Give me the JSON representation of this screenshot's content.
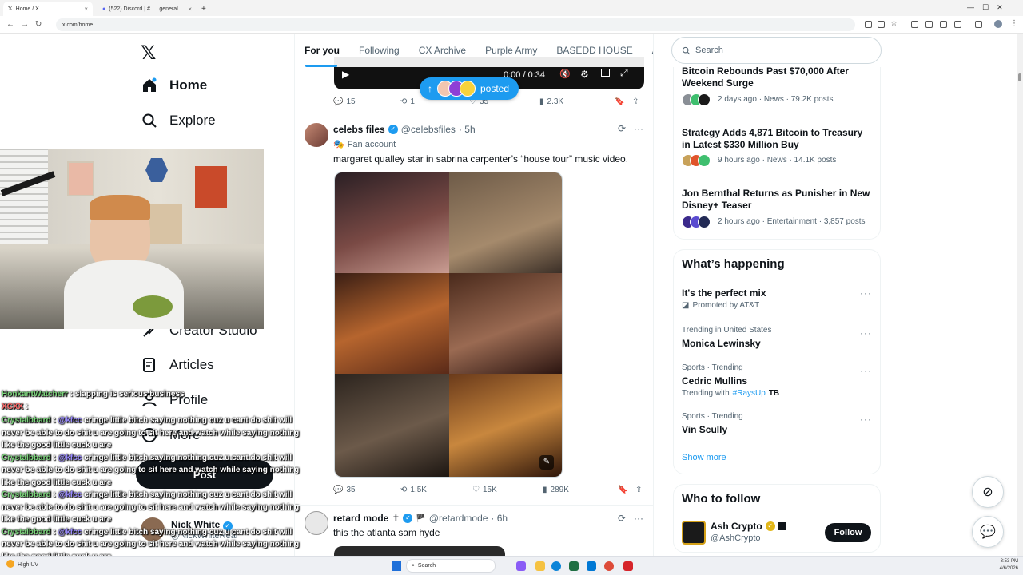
{
  "browser": {
    "tabs": [
      {
        "title": "Home / X"
      },
      {
        "title": "(522) Discord | #... | general"
      }
    ],
    "url": "x.com/home"
  },
  "left_nav": {
    "items": [
      {
        "label": "Home",
        "icon": "home-icon"
      },
      {
        "label": "Explore",
        "icon": "search-icon"
      },
      {
        "label": "Creator Studio",
        "icon": "creator-icon"
      },
      {
        "label": "Articles",
        "icon": "articles-icon"
      },
      {
        "label": "Profile",
        "icon": "profile-icon"
      },
      {
        "label": "More",
        "icon": "more-icon"
      }
    ],
    "post_button": "Post",
    "account": {
      "name": "Nick White",
      "handle": "@NickWhiteReal"
    }
  },
  "chat": [
    {
      "user": "HonkantWatcherr",
      "text": "slapping",
      "text2": "is serious business"
    },
    {
      "user": "XCXX",
      "text": ":"
    },
    {
      "user": "Crystalbbard",
      "mention": "@kfcc",
      "text": "cringe little bitch saying nothing cuz u cant do shit will never be able to do shit u are going to sit here and watch while saying nothing like the good little cuck u are"
    },
    {
      "user": "Crystalbbard",
      "mention": "@kfcc",
      "text": "cringe little bitch saying nothing cuz u cant do shit will never be able to do shit u are going to sit here and watch while saying nothing like the good little cuck u are"
    },
    {
      "user": "Crystalbbard",
      "mention": "@kfcc",
      "text": "cringe little bitch saying nothing cuz u cant do shit will never be able to do shit u are going to sit here and watch while saying nothing like the good little cuck u are"
    },
    {
      "user": "Crystalbbard",
      "mention": "@kfcc",
      "text": "cringe little bitch saying nothing cuz u cant do shit will never be able to do shit u are going to sit here and watch while saying nothing like the good little cuck u are"
    }
  ],
  "feed": {
    "tabs": [
      "For you",
      "Following",
      "CX Archive",
      "Purple Army",
      "BASEDD HOUSE",
      "Ape"
    ],
    "new_posts_pill": "posted",
    "video_time": "0:00 / 0:34",
    "post1_actions": {
      "replies": "15",
      "reposts": "1",
      "likes": "35",
      "views": "2.3K"
    },
    "post2": {
      "name": "celebs files",
      "handle": "@celebsfiles",
      "time": "· 5h",
      "label": "Fan account",
      "text": "margaret qualley star in sabrina carpenter’s “house tour” music video.",
      "actions": {
        "replies": "35",
        "reposts": "1.5K",
        "likes": "15K",
        "views": "289K"
      }
    },
    "post3": {
      "name": "retard mode",
      "handle": "@retardmode",
      "time": "· 6h",
      "text": "this the atlanta sam hyde"
    }
  },
  "sidebar": {
    "search_placeholder": "Search",
    "news": [
      {
        "title": "Bitcoin Rebounds Past $70,000 After Weekend Surge",
        "meta": "2 days ago · News · 79.2K posts"
      },
      {
        "title": "Strategy Adds 4,871 Bitcoin to Treasury in Latest $330 Million Buy",
        "meta": "9 hours ago · News · 14.1K posts"
      },
      {
        "title": "Jon Bernthal Returns as Punisher in New Disney+ Teaser",
        "meta": "2 hours ago · Entertainment · 3,857 posts"
      }
    ],
    "whats_happening": {
      "title": "What’s happening",
      "items": [
        {
          "context": "",
          "name": "It's the perfect mix",
          "extra": "Promoted by AT&T"
        },
        {
          "context": "Trending in United States",
          "name": "Monica Lewinsky",
          "extra": ""
        },
        {
          "context": "Sports · Trending",
          "name": "Cedric Mullins",
          "extra_prefix": "Trending with",
          "extra_tag": "#RaysUp"
        },
        {
          "context": "Sports · Trending",
          "name": "Vin Scully",
          "extra": ""
        }
      ],
      "show_more": "Show more"
    },
    "who_to_follow": {
      "title": "Who to follow",
      "name": "Ash Crypto",
      "handle": "@AshCrypto",
      "follow": "Follow"
    }
  },
  "taskbar": {
    "weather": "High UV",
    "search": "Search",
    "time": "3:53 PM",
    "date": "4/6/2026"
  },
  "colors": {
    "accent": "#1d9bf0",
    "text": "#0f1419",
    "muted": "#536471"
  }
}
